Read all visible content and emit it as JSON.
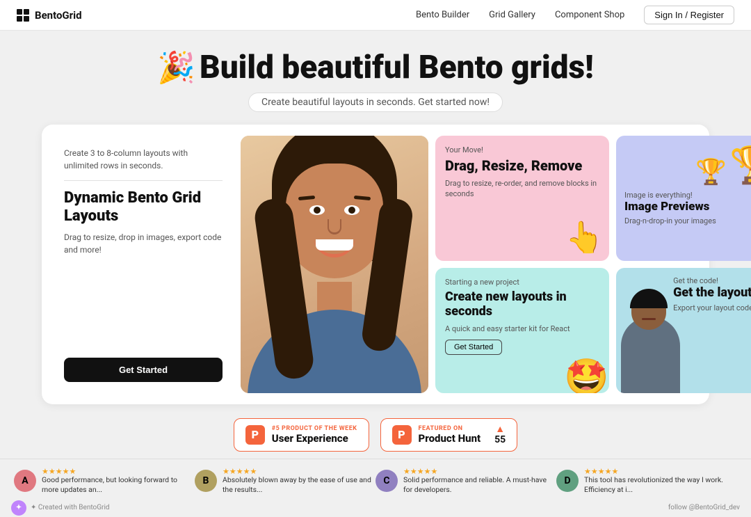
{
  "nav": {
    "logo": "BentoGrid",
    "links": [
      "Bento Builder",
      "Grid Gallery",
      "Component Shop"
    ],
    "signin": "Sign In / Register"
  },
  "hero": {
    "emoji": "🎉",
    "title": "Build beautiful Bento grids!",
    "subtitle": "Create beautiful layouts in seconds. Get started now!"
  },
  "bento": {
    "card_main": {
      "text": "Create 3 to 8-column layouts with unlimited rows in seconds.",
      "title": "Dynamic Bento Grid Layouts",
      "desc": "Drag to resize, drop in images, export code and more!",
      "btn": "Get Started"
    },
    "card_drag": {
      "label": "Your Move!",
      "title": "Drag, Resize, Remove",
      "desc": "Drag to resize, re-order, and remove blocks in seconds"
    },
    "card_image": {
      "label": "Image is everything!",
      "title": "Image Previews",
      "desc": "Drag-n-drop-in your images"
    },
    "card_create": {
      "label": "Starting a new project",
      "title": "Create new layouts in seconds",
      "desc": "A quick and easy starter kit for React",
      "btn": "Get Started"
    },
    "card_layout": {
      "label": "Get the code!",
      "title": "Get the layout!",
      "desc": "Export your layout code and i..."
    }
  },
  "product_hunt": {
    "badge1": {
      "rank": "#5 PRODUCT OF THE WEEK",
      "title": "User Experience"
    },
    "badge2": {
      "rank": "FEATURED ON",
      "title": "Product Hunt",
      "votes": "55"
    }
  },
  "reviews": [
    {
      "initials": "A",
      "color": "#e07880",
      "stars": "★★★★★",
      "text": "Good performance, but looking forward to more updates an..."
    },
    {
      "initials": "B",
      "color": "#b0a060",
      "stars": "★★★★★",
      "text": "Absolutely blown away by the ease of use and the results..."
    },
    {
      "initials": "C",
      "color": "#9080c0",
      "stars": "★★★★★",
      "text": "Solid performance and reliable. A must-have for developers."
    },
    {
      "initials": "D",
      "color": "#60a080",
      "stars": "★★★★★",
      "text": "This tool has revolutionized the way I work. Efficiency at i..."
    }
  ],
  "footer": {
    "left": "✦ Created with BentoGrid",
    "right": "follow @BentoGrid_dev"
  }
}
